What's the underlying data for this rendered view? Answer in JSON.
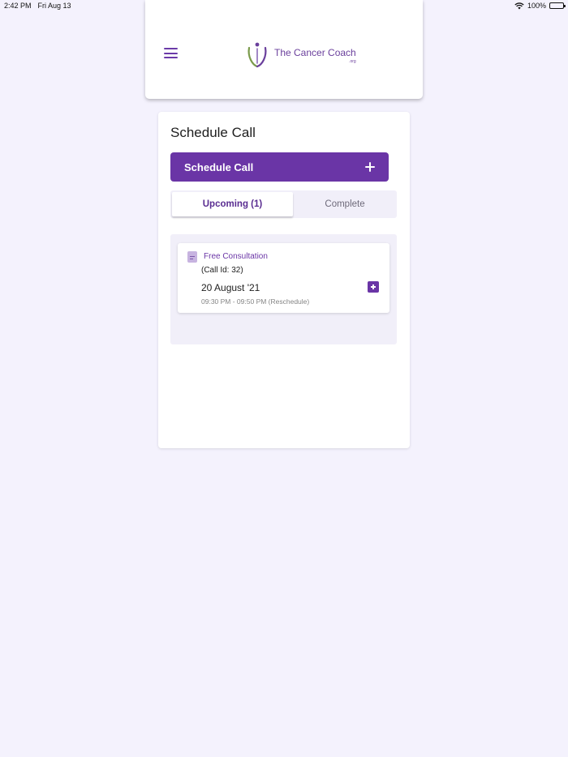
{
  "status_bar": {
    "time": "2:42 PM",
    "date": "Fri Aug 13",
    "battery": "100%"
  },
  "header": {
    "logo_text": "The Cancer Coach",
    "logo_suffix": ".org"
  },
  "main": {
    "title": "Schedule Call",
    "schedule_button_label": "Schedule Call",
    "tabs": [
      {
        "label": "Upcoming (1)",
        "active": true
      },
      {
        "label": "Complete",
        "active": false
      }
    ],
    "calls": [
      {
        "type": "Free Consultation",
        "call_id": "(Call Id: 32)",
        "date": "20 August '21",
        "time": "09:30 PM - 09:50 PM (Reschedule)"
      }
    ]
  },
  "colors": {
    "brand": "#6a35a6",
    "background": "#f4f2fd",
    "panel": "#f1eff9"
  }
}
